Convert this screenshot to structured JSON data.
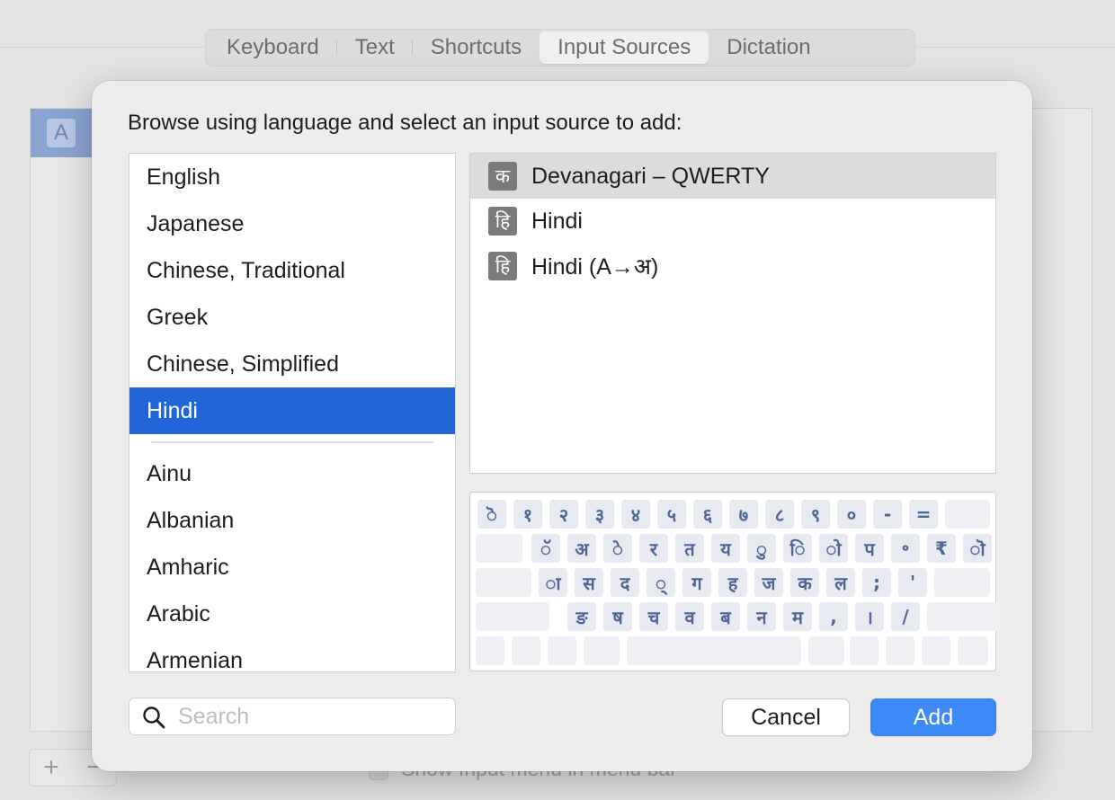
{
  "window": {
    "tabs": [
      {
        "label": "Keyboard",
        "active": false
      },
      {
        "label": "Text",
        "active": false
      },
      {
        "label": "Shortcuts",
        "active": false
      },
      {
        "label": "Input Sources",
        "active": true
      },
      {
        "label": "Dictation",
        "active": false
      }
    ],
    "selected_source_icon": "A",
    "add_label": "+",
    "remove_label": "−",
    "menu_option_label": "Show Input menu in menu bar"
  },
  "dialog": {
    "prompt": "Browse using language and select an input source to add:",
    "languages": {
      "preferred": [
        "English",
        "Japanese",
        "Chinese, Traditional",
        "Greek",
        "Chinese, Simplified",
        "Hindi"
      ],
      "other": [
        "Ainu",
        "Albanian",
        "Amharic",
        "Arabic",
        "Armenian"
      ],
      "selected": "Hindi"
    },
    "input_sources": [
      {
        "icon_glyph": "क",
        "label": "Devanagari – QWERTY",
        "selected": true
      },
      {
        "icon_glyph": "हि",
        "label": "Hindi",
        "selected": false
      },
      {
        "icon_glyph": "हि",
        "label": "Hindi (A→अ)",
        "selected": false
      }
    ],
    "keyboard_rows": [
      [
        "ॆ",
        "१",
        "२",
        "३",
        "४",
        "५",
        "६",
        "७",
        "८",
        "९",
        "०",
        "-",
        "="
      ],
      [
        "ॅ",
        "अ",
        "े",
        "र",
        "त",
        "य",
        "ु",
        "ि",
        "ो",
        "प",
        "॰",
        "₹",
        "ॊ"
      ],
      [
        "ा",
        "स",
        "द",
        "्",
        "ग",
        "ह",
        "ज",
        "क",
        "ल",
        ";",
        "'"
      ],
      [
        "ङ",
        "ष",
        "च",
        "व",
        "ब",
        "न",
        "म",
        ",",
        "।",
        "/"
      ]
    ],
    "search": {
      "placeholder": "Search",
      "value": ""
    },
    "buttons": {
      "cancel": "Cancel",
      "add": "Add"
    },
    "accent_color": "#2265d9",
    "add_button_color": "#3d8af7"
  }
}
